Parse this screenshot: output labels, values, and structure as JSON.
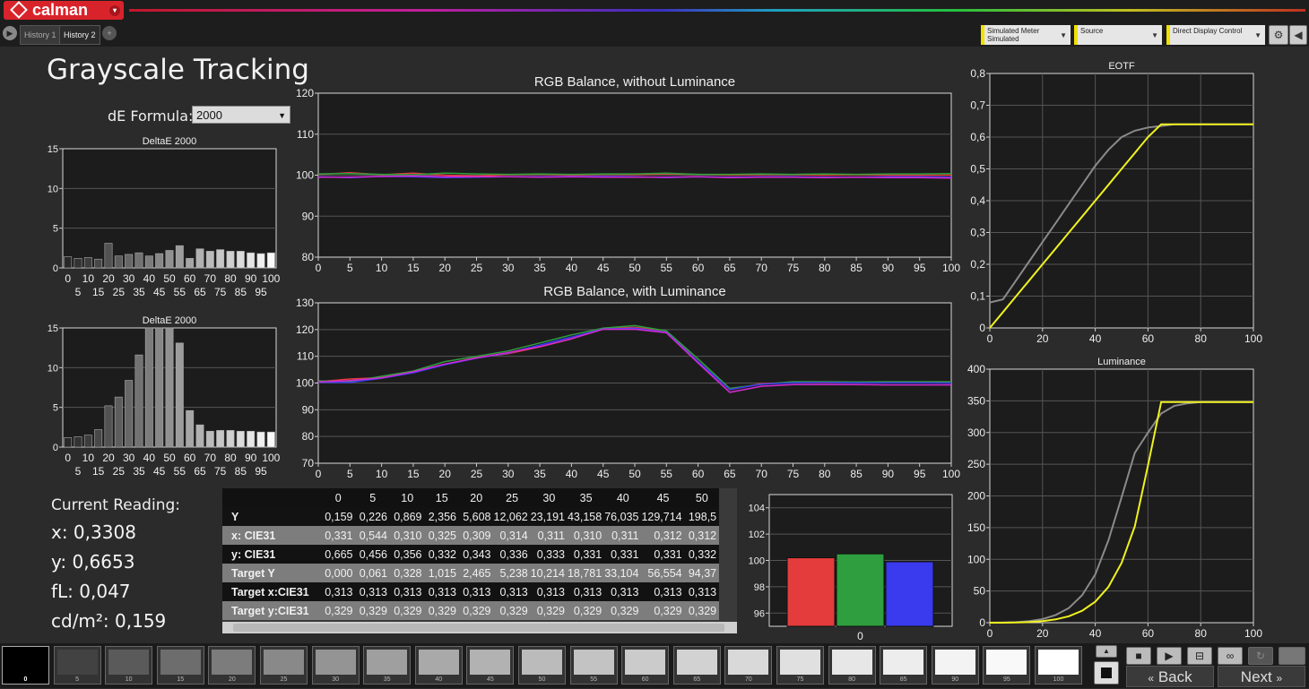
{
  "app": {
    "logo_text": "calman",
    "logo_menu": "▾"
  },
  "tabs": [
    {
      "label": "History 1",
      "active": false
    },
    {
      "label": "History 2",
      "active": true
    }
  ],
  "toolbar": {
    "meter_label": "Simulated Meter",
    "meter_value": "Simulated",
    "source_label": "Source",
    "ddc_label": "Direct Display Control",
    "gear": "⚙",
    "nav_left": "◀",
    "nav_right": "▶",
    "tab_add": "+"
  },
  "page": {
    "title": "Grayscale Tracking",
    "de_formula_label": "dE Formula:",
    "de_formula_value": "2000"
  },
  "current_reading": {
    "label": "Current Reading:",
    "x": "x: 0,3308",
    "y": "y: 0,6653",
    "fl": "fL: 0,047",
    "cdm2": "cd/m²: 0,159"
  },
  "table": {
    "columns": [
      "0",
      "5",
      "10",
      "15",
      "20",
      "25",
      "30",
      "35",
      "40",
      "45",
      "50"
    ],
    "rows": [
      {
        "label": "Y",
        "values": [
          "0,159",
          "0,226",
          "0,869",
          "2,356",
          "5,608",
          "12,062",
          "23,191",
          "43,158",
          "76,035",
          "129,714",
          "198,5"
        ]
      },
      {
        "label": "x: CIE31",
        "values": [
          "0,331",
          "0,544",
          "0,310",
          "0,325",
          "0,309",
          "0,314",
          "0,311",
          "0,310",
          "0,311",
          "0,312",
          "0,312"
        ]
      },
      {
        "label": "y: CIE31",
        "values": [
          "0,665",
          "0,456",
          "0,356",
          "0,332",
          "0,343",
          "0,336",
          "0,333",
          "0,331",
          "0,331",
          "0,331",
          "0,332"
        ]
      },
      {
        "label": "Target Y",
        "values": [
          "0,000",
          "0,061",
          "0,328",
          "1,015",
          "2,465",
          "5,238",
          "10,214",
          "18,781",
          "33,104",
          "56,554",
          "94,37"
        ]
      },
      {
        "label": "Target x:CIE31",
        "values": [
          "0,313",
          "0,313",
          "0,313",
          "0,313",
          "0,313",
          "0,313",
          "0,313",
          "0,313",
          "0,313",
          "0,313",
          "0,313"
        ]
      },
      {
        "label": "Target y:CIE31",
        "values": [
          "0,329",
          "0,329",
          "0,329",
          "0,329",
          "0,329",
          "0,329",
          "0,329",
          "0,329",
          "0,329",
          "0,329",
          "0,329"
        ]
      }
    ]
  },
  "swatches": [
    "0",
    "5",
    "10",
    "15",
    "20",
    "25",
    "30",
    "35",
    "40",
    "45",
    "50",
    "55",
    "60",
    "65",
    "70",
    "75",
    "80",
    "85",
    "90",
    "95",
    "100"
  ],
  "selected_swatch": "0",
  "nav": {
    "back": "Back",
    "next": "Next"
  },
  "colors": {
    "red": "#e43c3c",
    "green": "#2f9e3e",
    "blue": "#3a3aee",
    "magenta": "#d42ad4",
    "yellow": "#f0f020",
    "gray": "#8a8a8a"
  },
  "chart_data": [
    {
      "type": "bar",
      "title": "DeltaE 2000",
      "categories": [
        "0",
        "5",
        "10",
        "15",
        "20",
        "25",
        "30",
        "35",
        "40",
        "45",
        "50",
        "55",
        "60",
        "65",
        "70",
        "75",
        "80",
        "85",
        "90",
        "95",
        "100"
      ],
      "values": [
        1.4,
        1.2,
        1.3,
        1.1,
        3.1,
        1.5,
        1.7,
        1.9,
        1.5,
        1.8,
        2.2,
        2.8,
        1.2,
        2.4,
        2.1,
        2.3,
        2.1,
        2.1,
        1.9,
        1.8,
        1.9
      ],
      "ylim": [
        0,
        15
      ],
      "yticks": [
        "0",
        "5",
        "10",
        "15"
      ],
      "xticks_top": [
        "0",
        "10",
        "20",
        "30",
        "40",
        "50",
        "60",
        "70",
        "80",
        "90",
        "100"
      ],
      "xticks_bottom": [
        "5",
        "15",
        "25",
        "35",
        "45",
        "55",
        "65",
        "75",
        "85",
        "95"
      ]
    },
    {
      "type": "bar",
      "title": "DeltaE 2000",
      "categories": [
        "0",
        "5",
        "10",
        "15",
        "20",
        "25",
        "30",
        "35",
        "40",
        "45",
        "50",
        "55",
        "60",
        "65",
        "70",
        "75",
        "80",
        "85",
        "90",
        "95",
        "100"
      ],
      "values": [
        1.2,
        1.3,
        1.5,
        2.2,
        5.2,
        6.3,
        8.4,
        11.6,
        15,
        15,
        15,
        13.1,
        4.6,
        2.8,
        2.0,
        2.1,
        2.1,
        2.0,
        2.0,
        1.9,
        1.9
      ],
      "ylim": [
        0,
        15
      ],
      "yticks": [
        "0",
        "5",
        "10",
        "15"
      ],
      "xticks_top": [
        "0",
        "10",
        "20",
        "30",
        "40",
        "50",
        "60",
        "70",
        "80",
        "90",
        "100"
      ],
      "xticks_bottom": [
        "5",
        "15",
        "25",
        "35",
        "45",
        "55",
        "65",
        "75",
        "85",
        "95"
      ]
    },
    {
      "type": "line",
      "title": "RGB Balance, without Luminance",
      "x": [
        0,
        5,
        10,
        15,
        20,
        25,
        30,
        35,
        40,
        45,
        50,
        55,
        60,
        65,
        70,
        75,
        80,
        85,
        90,
        95,
        100
      ],
      "series": [
        {
          "color": "red",
          "values": [
            100.2,
            100.6,
            100.1,
            100.5,
            100.0,
            99.8,
            100.1,
            100.2,
            100.0,
            100.2,
            100.1,
            100.3,
            100.2,
            100.0,
            100.1,
            100.1,
            100.0,
            100.1,
            100.0,
            100.0,
            100.0
          ]
        },
        {
          "color": "green",
          "values": [
            100.3,
            100.4,
            100.2,
            100.1,
            100.5,
            100.3,
            100.2,
            100.3,
            100.2,
            100.3,
            100.3,
            100.5,
            100.2,
            100.2,
            100.3,
            100.2,
            100.3,
            100.2,
            100.3,
            100.3,
            100.4
          ]
        },
        {
          "color": "blue",
          "values": [
            99.6,
            99.4,
            99.7,
            99.6,
            99.4,
            99.5,
            99.6,
            99.6,
            99.7,
            99.7,
            99.6,
            99.4,
            99.6,
            99.5,
            99.6,
            99.6,
            99.5,
            99.5,
            99.6,
            99.6,
            99.5
          ]
        },
        {
          "color": "magenta",
          "values": [
            99.5,
            99.5,
            99.7,
            99.8,
            99.6,
            99.6,
            99.6,
            99.5,
            99.6,
            99.5,
            99.5,
            99.5,
            99.6,
            99.4,
            99.5,
            99.5,
            99.4,
            99.5,
            99.4,
            99.4,
            99.3
          ]
        }
      ],
      "ylim": [
        80,
        120
      ],
      "yticks": [
        "80",
        "90",
        "100",
        "110",
        "120"
      ],
      "xticks": [
        "0",
        "5",
        "10",
        "15",
        "20",
        "25",
        "30",
        "35",
        "40",
        "45",
        "50",
        "55",
        "60",
        "65",
        "70",
        "75",
        "80",
        "85",
        "90",
        "95",
        "100"
      ]
    },
    {
      "type": "line",
      "title": "RGB Balance, with Luminance",
      "x": [
        0,
        5,
        10,
        15,
        20,
        25,
        30,
        35,
        40,
        45,
        50,
        55,
        60,
        65,
        70,
        75,
        80,
        85,
        90,
        95,
        100
      ],
      "series": [
        {
          "color": "red",
          "values": [
            100.5,
            101.5,
            102,
            104,
            107,
            109.5,
            111,
            113.5,
            116.5,
            120.5,
            120.8,
            119.5,
            108,
            97.5,
            99.8,
            100.2,
            100.1,
            100.2,
            100.1,
            100.1,
            100.2
          ]
        },
        {
          "color": "green",
          "values": [
            100.8,
            100.5,
            102.5,
            104.5,
            108,
            110,
            112,
            115,
            118,
            120.5,
            121.5,
            119.5,
            109,
            98,
            99.5,
            100.5,
            100.5,
            100.4,
            100.5,
            100.5,
            100.5
          ]
        },
        {
          "color": "blue",
          "values": [
            100.3,
            100.2,
            101.8,
            103.8,
            106.8,
            109.3,
            111.2,
            114.2,
            117.2,
            120.2,
            120.5,
            119,
            108,
            97.6,
            99.6,
            100.1,
            100.2,
            100.1,
            100.1,
            100.1,
            100
          ]
        },
        {
          "color": "magenta",
          "values": [
            100.4,
            100.9,
            101.9,
            104.2,
            107.1,
            109.4,
            111.4,
            113.6,
            116.6,
            120.1,
            120.1,
            118.8,
            107.5,
            96.5,
            98.8,
            99.4,
            99.4,
            99.4,
            99.3,
            99.3,
            99.3
          ]
        }
      ],
      "ylim": [
        70,
        130
      ],
      "yticks": [
        "70",
        "80",
        "90",
        "100",
        "110",
        "120",
        "130"
      ],
      "xticks": [
        "0",
        "5",
        "10",
        "15",
        "20",
        "25",
        "30",
        "35",
        "40",
        "45",
        "50",
        "55",
        "60",
        "65",
        "70",
        "75",
        "80",
        "85",
        "90",
        "95",
        "100"
      ]
    },
    {
      "type": "line",
      "title": "EOTF",
      "x": [
        0,
        5,
        10,
        15,
        20,
        25,
        30,
        35,
        40,
        45,
        50,
        55,
        60,
        65,
        70,
        75,
        80,
        85,
        90,
        95,
        100
      ],
      "series": [
        {
          "color": "gray",
          "values": [
            0.08,
            0.09,
            0.15,
            0.21,
            0.27,
            0.33,
            0.39,
            0.45,
            0.51,
            0.56,
            0.6,
            0.62,
            0.63,
            0.635,
            0.64,
            0.64,
            0.64,
            0.64,
            0.64,
            0.64,
            0.64
          ]
        },
        {
          "color": "yellow",
          "values": [
            0,
            0.05,
            0.1,
            0.15,
            0.2,
            0.25,
            0.3,
            0.35,
            0.4,
            0.45,
            0.5,
            0.55,
            0.6,
            0.64,
            0.64,
            0.64,
            0.64,
            0.64,
            0.64,
            0.64,
            0.64
          ]
        }
      ],
      "ylim": [
        0,
        0.8
      ],
      "yticks": [
        "0",
        "0,1",
        "0,2",
        "0,3",
        "0,4",
        "0,5",
        "0,6",
        "0,7",
        "0,8"
      ],
      "xticks": [
        "0",
        "20",
        "40",
        "60",
        "80",
        "100"
      ]
    },
    {
      "type": "line",
      "title": "Luminance",
      "x": [
        0,
        5,
        10,
        15,
        20,
        25,
        30,
        35,
        40,
        45,
        50,
        55,
        60,
        65,
        70,
        75,
        80,
        85,
        90,
        95,
        100
      ],
      "series": [
        {
          "color": "gray",
          "values": [
            0.2,
            0.3,
            0.9,
            2.4,
            5.6,
            12.1,
            23.2,
            43.2,
            76,
            130,
            198,
            268,
            300,
            330,
            342,
            346,
            348,
            348,
            348,
            348,
            348
          ]
        },
        {
          "color": "yellow",
          "values": [
            0,
            0.06,
            0.33,
            1,
            2.5,
            5.2,
            10.2,
            18.8,
            33.1,
            56.6,
            94.4,
            152,
            248,
            348,
            348,
            348,
            348,
            348,
            348,
            348,
            348
          ]
        }
      ],
      "ylim": [
        0,
        400
      ],
      "yticks": [
        "0",
        "50",
        "100",
        "150",
        "200",
        "250",
        "300",
        "350",
        "400"
      ],
      "xticks": [
        "0",
        "20",
        "40",
        "60",
        "80",
        "100"
      ]
    },
    {
      "type": "bar",
      "categories": [
        "0"
      ],
      "series": [
        {
          "color": "red",
          "values": [
            100.2
          ]
        },
        {
          "color": "green",
          "values": [
            100.5
          ]
        },
        {
          "color": "blue",
          "values": [
            99.9
          ]
        }
      ],
      "ylim": [
        95,
        105
      ],
      "yticks": [
        "96",
        "98",
        "100",
        "102",
        "104"
      ],
      "xticks": [
        "0"
      ]
    }
  ]
}
